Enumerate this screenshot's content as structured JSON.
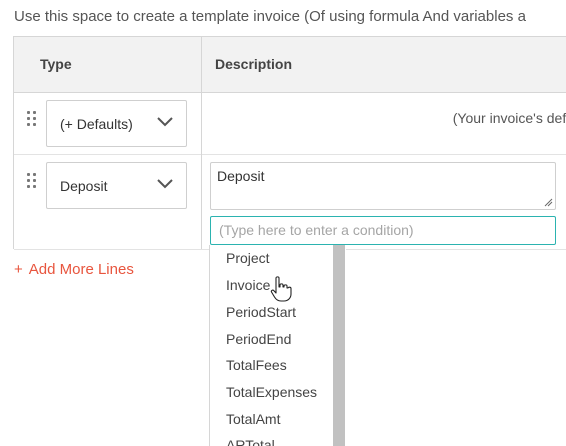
{
  "intro_text": "Use this space to create a template invoice (Of using formula And variables a",
  "table": {
    "headers": {
      "type": "Type",
      "description": "Description"
    },
    "rows": [
      {
        "type": "(+ Defaults)",
        "description_note": "(Your invoice's defa"
      },
      {
        "type": "Deposit",
        "description": "Deposit",
        "condition_placeholder": "(Type here to enter a condition)"
      }
    ]
  },
  "add_more_lines": {
    "icon": "+",
    "label": "Add More Lines"
  },
  "variables_dropdown": {
    "items": [
      "Project",
      "Invoice",
      "PeriodStart",
      "PeriodEnd",
      "TotalFees",
      "TotalExpenses",
      "TotalAmt",
      "ARTotal"
    ],
    "hovered": "Invoice"
  },
  "colors": {
    "accent": "#e8553e",
    "focus_border": "#2bb3b0",
    "header_bg": "#f2f2f2"
  }
}
